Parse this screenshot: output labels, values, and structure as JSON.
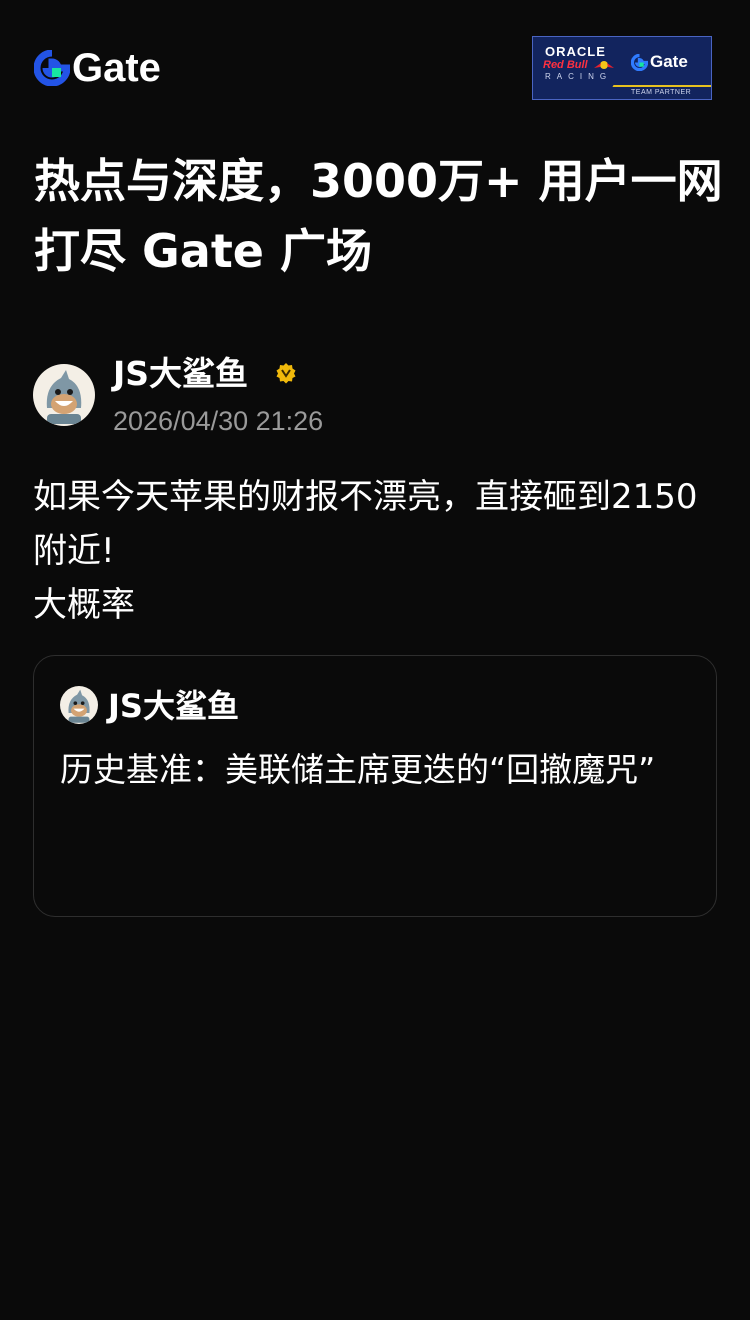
{
  "brand": {
    "name": "Gate"
  },
  "partner_badge": {
    "line1": "ORACLE",
    "line2": "Red Bull",
    "line3": "RACING",
    "brand": "Gate",
    "caption": "TEAM PARTNER"
  },
  "headline": {
    "text": "热点与深度，3000万+ 用户一网打尽 Gate 广场"
  },
  "post": {
    "author": "JS大鲨鱼",
    "verified_icon": "verified-badge-icon",
    "timestamp": "2026/04/30 21:26",
    "body_line1": "如果今天苹果的财报不漂亮，直接砸到2150附近!",
    "body_line2": "大概率"
  },
  "quoted_post": {
    "author": "JS大鲨鱼",
    "text": "历史基准：美联储主席更迭的“回撤魔咒”"
  },
  "colors": {
    "background": "#0a0a0a",
    "brand_blue": "#2354e6",
    "brand_teal": "#17e6a1",
    "verified_gold": "#f0b90b",
    "muted_text": "#9a9a9a",
    "card_border": "#2e2e2e"
  }
}
